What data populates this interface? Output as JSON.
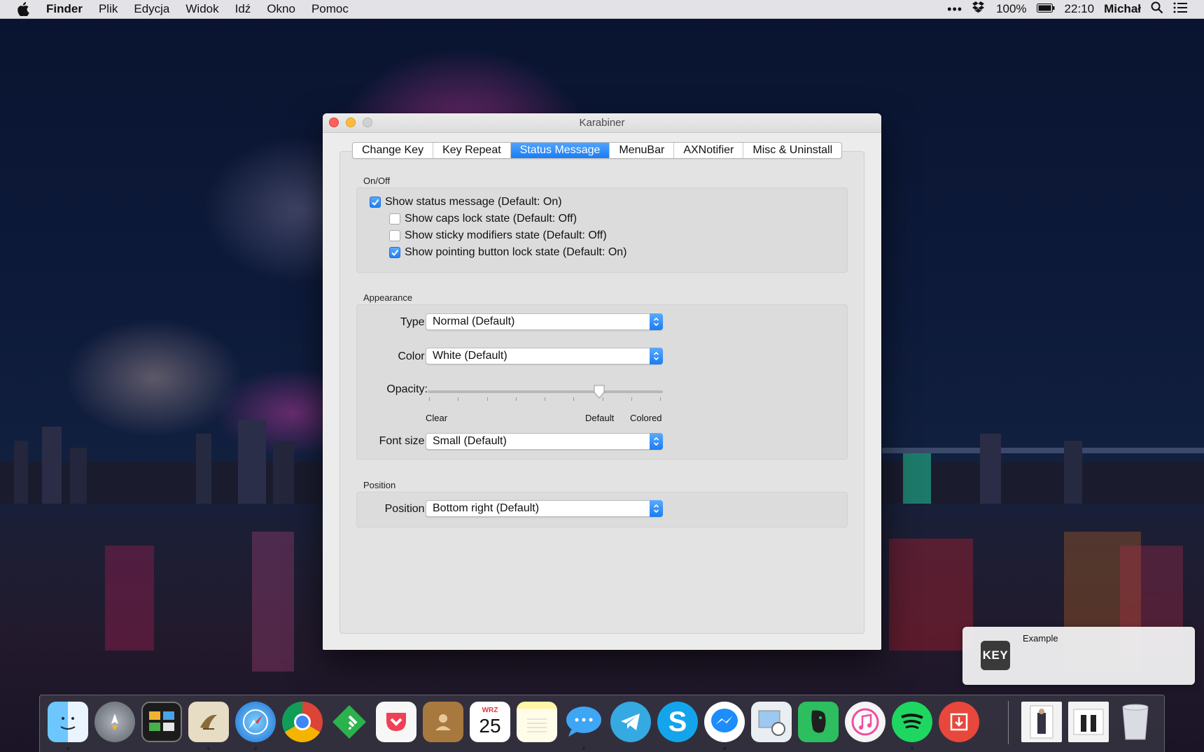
{
  "menubar": {
    "app_name": "Finder",
    "menus": [
      "Plik",
      "Edycja",
      "Widok",
      "Idź",
      "Okno",
      "Pomoc"
    ],
    "battery": "100%",
    "time": "22:10",
    "user": "Michał",
    "icons": [
      "apple-icon",
      "more-icon",
      "dropbox-icon",
      "battery-icon",
      "spotlight-icon",
      "notification-center-icon"
    ]
  },
  "window": {
    "title": "Karabiner",
    "tabs": [
      "Change Key",
      "Key Repeat",
      "Status Message",
      "MenuBar",
      "AXNotifier",
      "Misc & Uninstall"
    ],
    "active_tab": "Status Message",
    "onoff": {
      "label": "On/Off",
      "items": [
        {
          "label": "Show status message (Default: On)",
          "checked": true
        },
        {
          "label": "Show caps lock state (Default: Off)",
          "checked": false
        },
        {
          "label": "Show sticky modifiers state (Default: Off)",
          "checked": false
        },
        {
          "label": "Show pointing button lock state (Default: On)",
          "checked": true
        }
      ]
    },
    "appearance": {
      "label": "Appearance",
      "type_label": "Type:",
      "type_value": "Normal (Default)",
      "color_label": "Color:",
      "color_value": "White (Default)",
      "opacity_label": "Opacity:",
      "opacity_level": 0.73,
      "opacity_clear": "Clear",
      "opacity_default": "Default",
      "opacity_colored": "Colored",
      "fontsize_label": "Font size:",
      "fontsize_value": "Small (Default)"
    },
    "position": {
      "label": "Position",
      "position_label": "Position:",
      "position_value": "Bottom right (Default)"
    }
  },
  "notification": {
    "icon_text": "KEY",
    "title": "Example"
  },
  "dock": {
    "apps": [
      "Finder",
      "Launchpad",
      "Mission Control",
      "Mail",
      "Safari",
      "Chrome",
      "Feedly",
      "Pocket",
      "Contacts",
      "Calendar",
      "Notes",
      "Messages",
      "Telegram",
      "Skype",
      "Messenger",
      "Preview",
      "Evernote",
      "iTunes",
      "Spotify",
      "Transmit",
      "Downloads",
      "Documents",
      "Trash"
    ],
    "calendar_month": "WRZ",
    "calendar_day": "25"
  },
  "colors": {
    "accent": "#1a7df5",
    "close": "#fc605c",
    "minimize": "#fdbc40"
  }
}
